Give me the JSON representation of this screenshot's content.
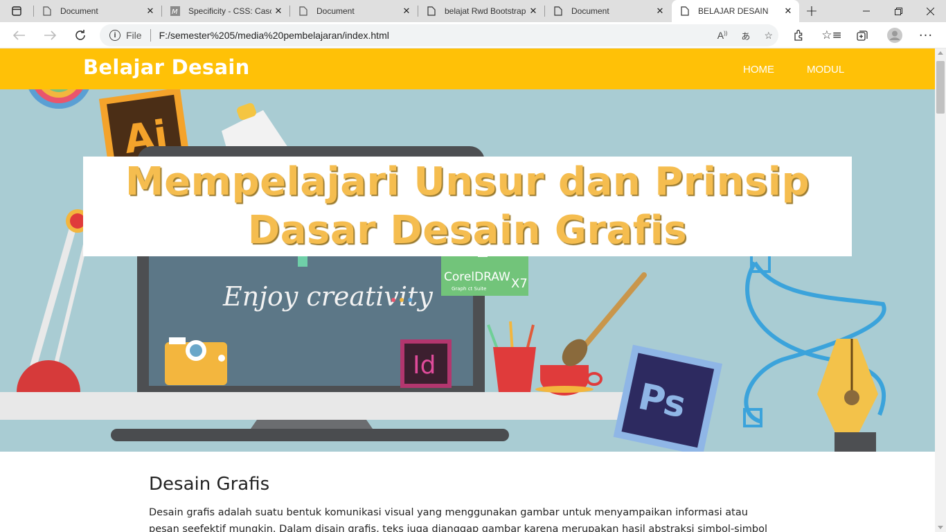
{
  "browser": {
    "tabs": [
      {
        "title": "Document",
        "active": false
      },
      {
        "title": "Specificity - CSS: Casca",
        "active": false
      },
      {
        "title": "Document",
        "active": false
      },
      {
        "title": "belajat Rwd Bootstrap",
        "active": false
      },
      {
        "title": "Document",
        "active": false
      },
      {
        "title": "BELAJAR DESAIN",
        "active": true
      }
    ],
    "address": {
      "scheme_label": "File",
      "url": "F:/semester%205/media%20pembelajaran/index.html"
    }
  },
  "page": {
    "navbar": {
      "brand": "Belajar Desain",
      "links": [
        "HOME",
        "MODUL"
      ],
      "color": "#ffc107"
    },
    "hero": {
      "title_line1": "Mempelajari Unsur dan Prinsip",
      "title_line2": "Dasar Desain Grafis",
      "illustration": {
        "screen_text": "Enjoy creativity",
        "coreldraw_label": "CorelDRAW",
        "coreldraw_version": "X7",
        "coreldraw_sub": "Graph ct Suite",
        "ai_label": "Ai",
        "id_label": "Id",
        "ps_label": "Ps"
      }
    },
    "section": {
      "heading": "Desain Grafis",
      "paragraph": "Desain grafis adalah suatu bentuk komunikasi visual yang menggunakan gambar untuk menyampaikan informasi atau pesan seefektif mungkin. Dalam disain grafis, teks juga dianggap gambar karena merupakan hasil abstraksi simbol-simbol yang bisa"
    }
  }
}
